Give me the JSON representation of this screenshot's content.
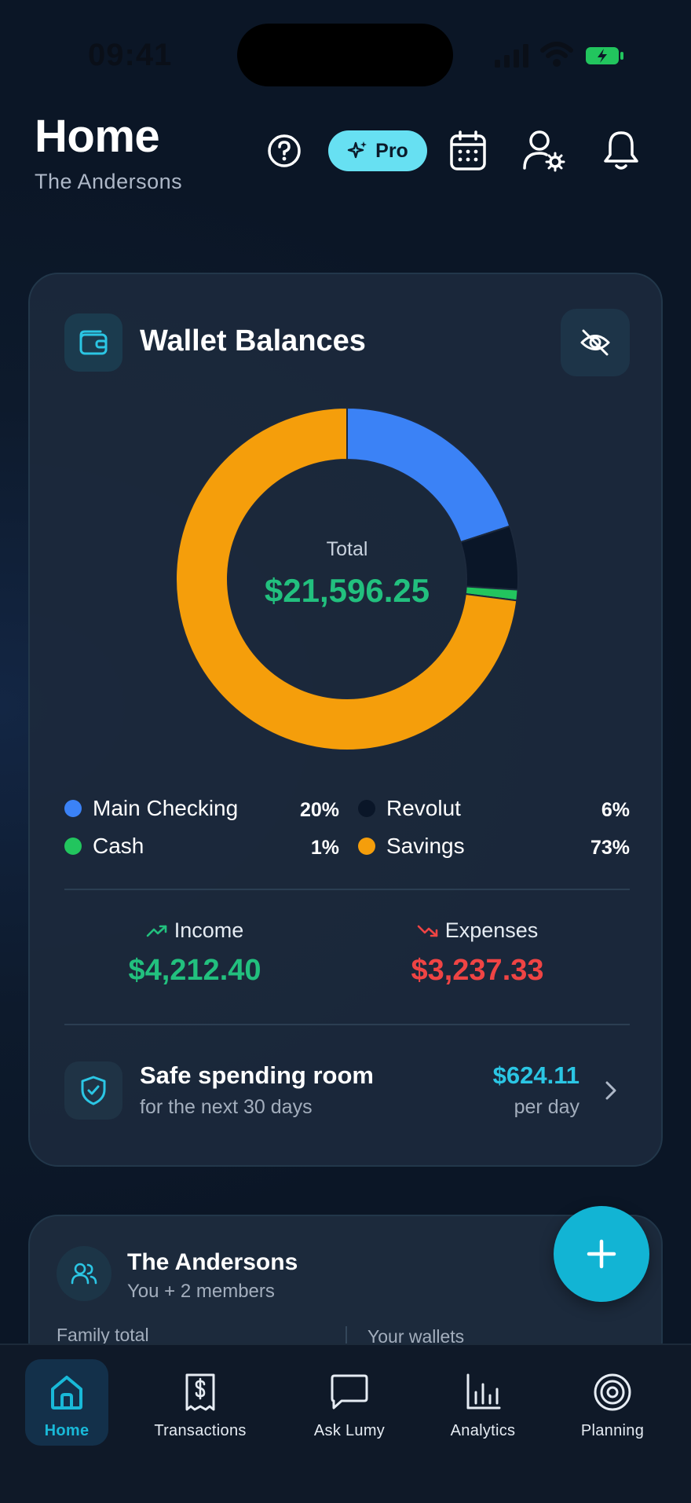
{
  "status_bar": {
    "time": "09:41"
  },
  "header": {
    "title": "Home",
    "subtitle": "The Andersons",
    "pro_label": "Pro",
    "icons": [
      "help-icon",
      "sparkles-icon",
      "calendar-icon",
      "user-settings-icon",
      "bell-icon"
    ]
  },
  "wallet_card": {
    "title": "Wallet Balances",
    "total_label": "Total",
    "total_value": "$21,596.25",
    "legend": [
      {
        "label": "Main Checking",
        "pct": "20%",
        "color": "#3b82f6"
      },
      {
        "label": "Revolut",
        "pct": "6%",
        "color": "#0a1628"
      },
      {
        "label": "Cash",
        "pct": "1%",
        "color": "#22c55e"
      },
      {
        "label": "Savings",
        "pct": "73%",
        "color": "#f59e0b"
      }
    ],
    "income_label": "Income",
    "income_value": "$4,212.40",
    "expenses_label": "Expenses",
    "expenses_value": "$3,237.33",
    "safe_title": "Safe spending room",
    "safe_sub": "for the next 30 days",
    "safe_amount": "$624.11",
    "safe_per": "per day",
    "colors": {
      "income": "#22c07e",
      "expenses": "#ef4444",
      "accent": "#2bc6e4"
    }
  },
  "chart_data": {
    "type": "pie",
    "categories": [
      "Main Checking",
      "Revolut",
      "Cash",
      "Savings"
    ],
    "values": [
      20,
      6,
      1,
      73
    ],
    "colors": [
      "#3b82f6",
      "#0a1628",
      "#22c55e",
      "#f59e0b"
    ]
  },
  "family_card": {
    "title": "The Andersons",
    "subtitle": "You + 2 members",
    "col1": "Family total",
    "col2": "Your wallets"
  },
  "fab": {
    "icon": "plus-icon"
  },
  "tabs": [
    {
      "label": "Home",
      "icon": "home-icon",
      "active": true
    },
    {
      "label": "Transactions",
      "icon": "receipt-icon",
      "active": false
    },
    {
      "label": "Ask Lumy",
      "icon": "chat-icon",
      "active": false
    },
    {
      "label": "Analytics",
      "icon": "bar-chart-icon",
      "active": false
    },
    {
      "label": "Planning",
      "icon": "target-icon",
      "active": false
    }
  ]
}
